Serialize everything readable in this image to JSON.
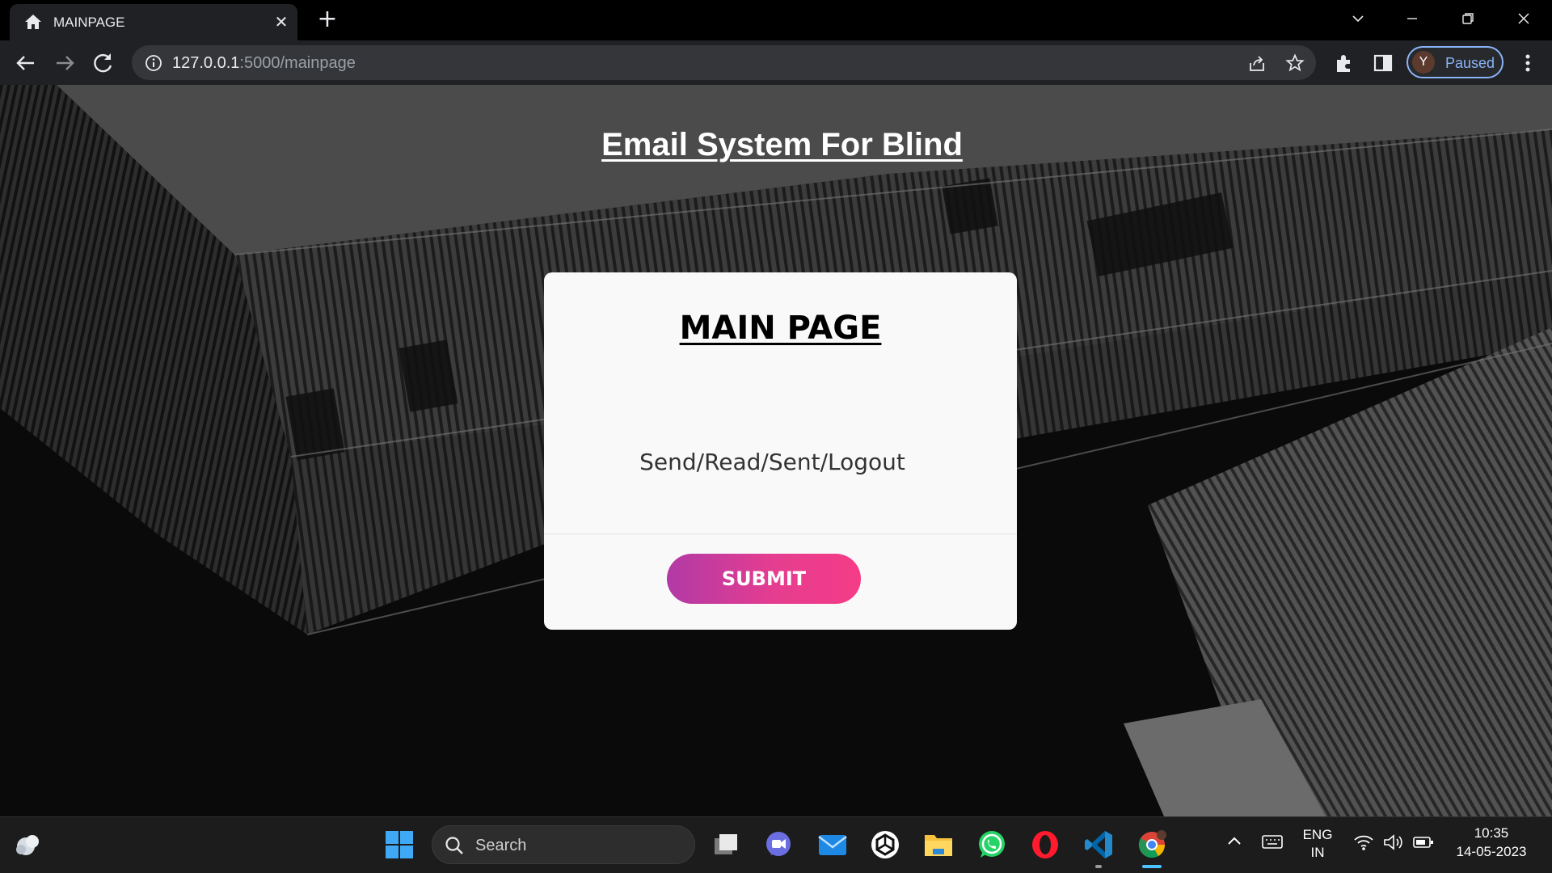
{
  "browser": {
    "tab": {
      "title": "MAINPAGE",
      "close_glyph": "✕",
      "favicon": "home-icon"
    },
    "new_tab_glyph": "+",
    "url": {
      "host": "127.0.0.1",
      "path": ":5000/mainpage"
    },
    "profile": {
      "initial": "Y",
      "label": "Paused"
    }
  },
  "page": {
    "heading": "Email System For Blind",
    "card": {
      "title": "MAIN PAGE",
      "options_text": "Send/Read/Sent/Logout",
      "submit_label": "SUBMIT"
    }
  },
  "taskbar": {
    "search_label": "Search",
    "language": {
      "line1": "ENG",
      "line2": "IN"
    },
    "clock": {
      "time": "10:35",
      "date": "14-05-2023"
    },
    "apps": [
      "widgets-icon",
      "start-icon",
      "task-view-icon",
      "teams-chat-icon",
      "mail-icon",
      "chatgpt-icon",
      "file-explorer-icon",
      "whatsapp-icon",
      "opera-icon",
      "vscode-icon",
      "chrome-icon"
    ]
  },
  "colors": {
    "submit_gradient_start": "#b13aa5",
    "submit_gradient_end": "#f53c86",
    "profile_accent": "#8ab4f8",
    "taskbar_active": "#4cc2ff"
  }
}
